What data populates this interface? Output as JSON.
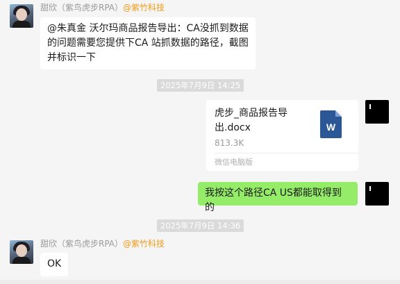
{
  "messages": {
    "first": {
      "sender_name": "甜欣（紫鸟虎步RPA）",
      "sender_org": "@紫竹科技",
      "text": "@朱真金 沃尔玛商品报告导出：CA没抓到数据的问题需要您提供下CA 站抓数据的路径，截图并标识一下"
    },
    "timestamp_1": "2025年7月9日 14:25",
    "file": {
      "name": "虎步_商品报告导出.docx",
      "size": "813.3K",
      "source": "微信电脑版",
      "icon_letter": "W"
    },
    "reply": {
      "text": "我按这个路径CA US都能取得到的"
    },
    "timestamp_2": "2025年7月9日 14:36",
    "last": {
      "sender_name": "甜欣（紫鸟虎步RPA）",
      "sender_org": "@紫竹科技",
      "text": "OK"
    }
  },
  "colors": {
    "background": "#f5f5f5",
    "bubble_self": "#95ec69",
    "bubble_other": "#ffffff",
    "org_tag": "#f29b1a",
    "word_icon": "#2b5797"
  },
  "icons": {
    "file_type": "word-document-icon",
    "avatar_other": "avatar-photo",
    "avatar_self": "avatar-black"
  }
}
